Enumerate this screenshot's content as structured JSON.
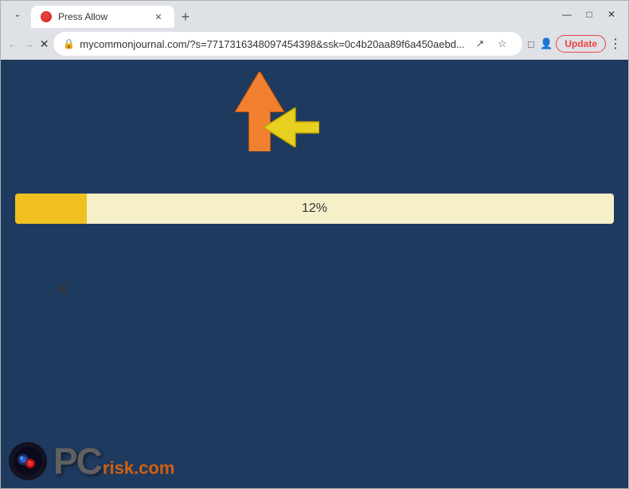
{
  "browser": {
    "tab": {
      "title": "Press Allow",
      "favicon": "●"
    },
    "new_tab_label": "+",
    "window_controls": {
      "minimize": "—",
      "maximize": "□",
      "close": "✕",
      "chevron_down": "⌄"
    },
    "nav": {
      "back": "←",
      "forward": "→",
      "reload": "✕"
    },
    "address_bar": {
      "url": "mycommonjournal.com/?s=7717316348097454398&ssk=0c4b20aa89f6a450aebd...",
      "lock_icon": "🔒"
    },
    "toolbar_icons": {
      "share": "↗",
      "bookmark": "☆",
      "extension": "□",
      "profile": "👤"
    },
    "update_button": "Update",
    "more_button": "⋮"
  },
  "page": {
    "progress_percent": "12%",
    "progress_value": 12,
    "background_color": "#1e3a5f",
    "arrows": {
      "orange_direction": "up-left",
      "yellow_direction": "left"
    },
    "logo": {
      "site": "PC",
      "suffix": "risk.com"
    }
  }
}
